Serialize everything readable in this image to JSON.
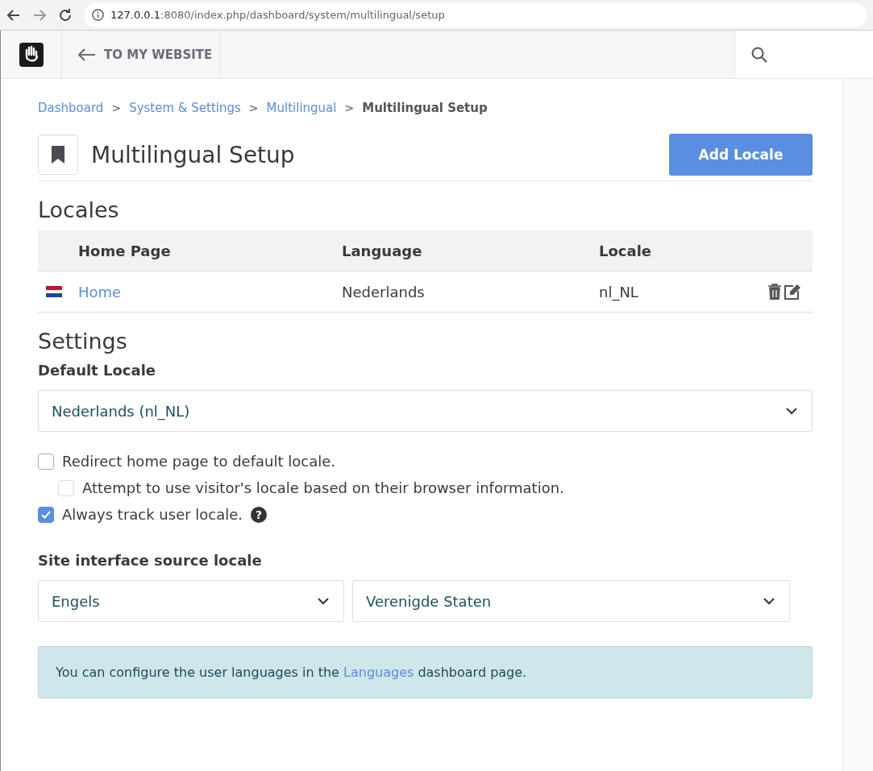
{
  "browser": {
    "url_host": "127.0.0.1",
    "url_path": ":8080/index.php/dashboard/system/multilingual/setup"
  },
  "toolbar": {
    "back_link": "TO MY WEBSITE"
  },
  "breadcrumbs": [
    {
      "label": "Dashboard",
      "current": false
    },
    {
      "label": "System & Settings",
      "current": false
    },
    {
      "label": "Multilingual",
      "current": false
    },
    {
      "label": "Multilingual Setup",
      "current": true
    }
  ],
  "breadcrumb_separator": ">",
  "page": {
    "title": "Multilingual Setup",
    "add_button": "Add Locale"
  },
  "locales": {
    "heading": "Locales",
    "columns": [
      "Home Page",
      "Language",
      "Locale"
    ],
    "rows": [
      {
        "home_page": "Home",
        "language": "Nederlands",
        "locale": "nl_NL"
      }
    ]
  },
  "settings": {
    "heading": "Settings",
    "default_locale_label": "Default Locale",
    "default_locale_value": "Nederlands (nl_NL)",
    "options": [
      {
        "kind": "option",
        "label": "Redirect home page to default locale.",
        "checked": false,
        "disabled": false
      },
      {
        "kind": "sub_option",
        "label": "Attempt to use visitor's locale based on their browser information.",
        "checked": false,
        "disabled": true
      },
      {
        "kind": "option",
        "label": "Always track user locale.",
        "checked": true,
        "disabled": false,
        "help_icon": "?"
      }
    ],
    "source_locale_label": "Site interface source locale",
    "source_language": "Engels",
    "source_country": "Verenigde Staten"
  },
  "info": {
    "before": "You can configure the user languages in the",
    "link": "Languages",
    "after": "dashboard page."
  }
}
